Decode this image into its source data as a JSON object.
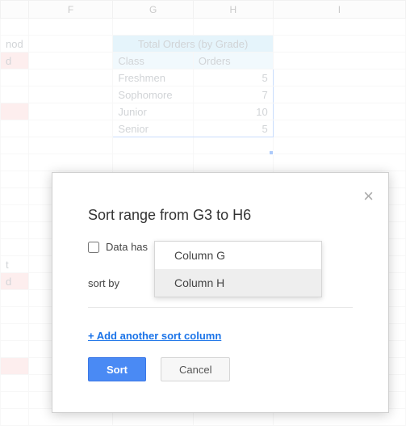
{
  "columns": {
    "F": "F",
    "G": "G",
    "H": "H",
    "I": "I"
  },
  "sidebar_fragments": {
    "r2": "nod",
    "r3": "d",
    "r15": "t",
    "r16": "d"
  },
  "table": {
    "title": "Total Orders (by Grade)",
    "header_class": "Class",
    "header_orders": "Orders",
    "rows": [
      {
        "class": "Freshmen",
        "orders": "5"
      },
      {
        "class": "Sophomore",
        "orders": "7"
      },
      {
        "class": "Junior",
        "orders": "10"
      },
      {
        "class": "Senior",
        "orders": "5"
      }
    ]
  },
  "dialog": {
    "title": "Sort range from G3 to H6",
    "checkbox_label": "Data has",
    "sortby_label": "sort by",
    "add_link": "+ Add another sort column",
    "sort_btn": "Sort",
    "cancel_btn": "Cancel",
    "close_icon": "×",
    "options": {
      "g": "Column G",
      "h": "Column H"
    }
  }
}
